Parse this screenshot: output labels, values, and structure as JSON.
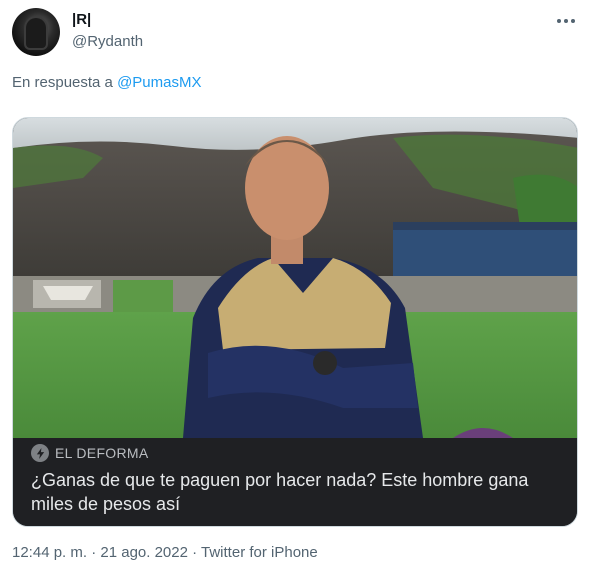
{
  "tweet": {
    "display_name": "|R|",
    "handle": "@Rydanth",
    "reply_prefix": "En respuesta a",
    "reply_to": "@PumasMX",
    "timestamp": "12:44 p. m. · 21 ago. 2022 · Twitter for iPhone"
  },
  "card": {
    "source": "EL DEFORMA",
    "headline": "¿Ganas de que te paguen por hacer nada? Este hombre gana miles de pesos así"
  },
  "icons": {
    "more": "more-horizontal-icon",
    "source": "bolt-icon"
  },
  "colors": {
    "link": "#1d9bf0",
    "secondary_text": "#536471",
    "card_bar": "#1f2023"
  }
}
